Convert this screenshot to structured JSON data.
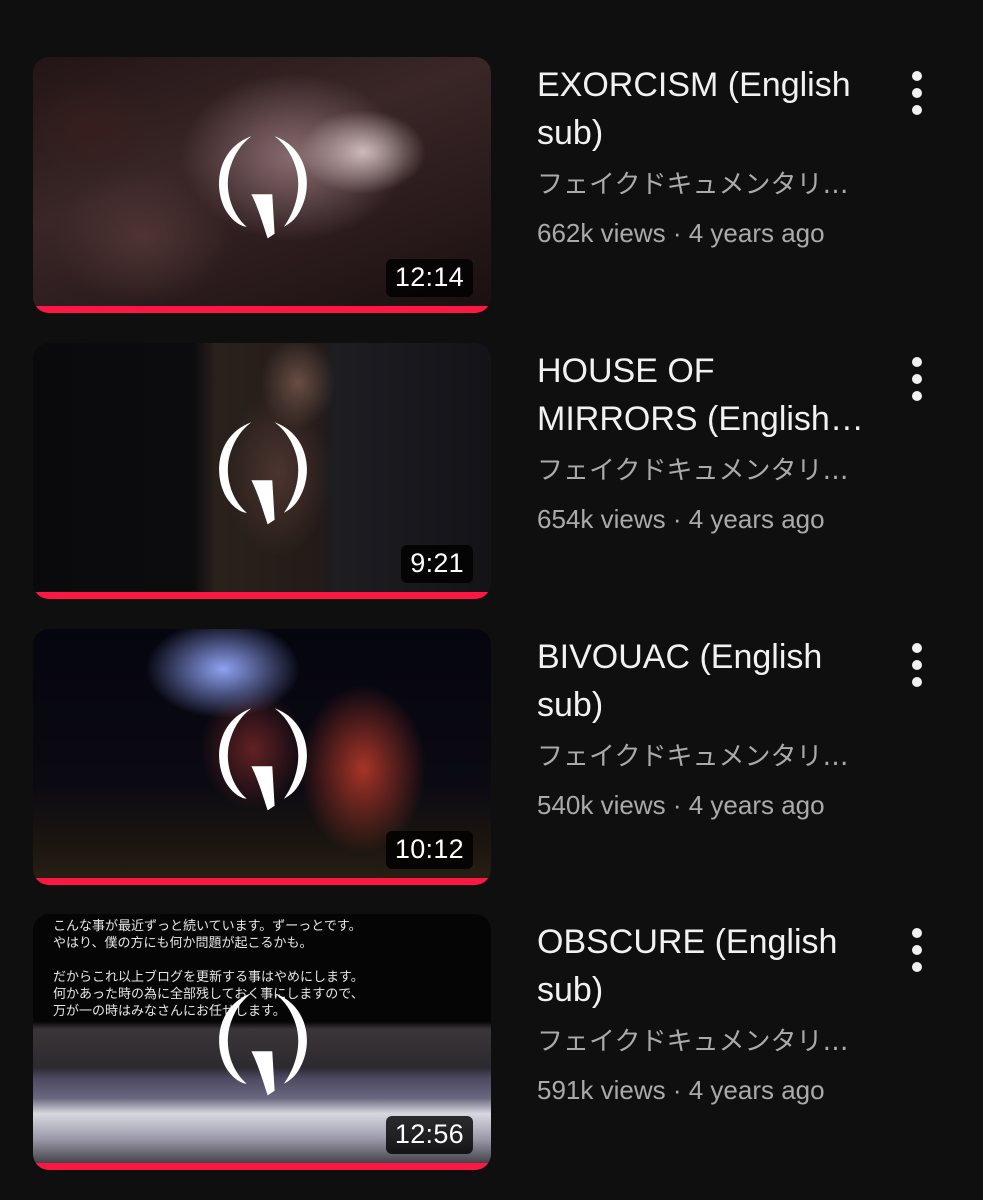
{
  "videos": [
    {
      "title": "EXORCISM (English sub)",
      "channel": "フェイクドキュメンタリー「Q」",
      "views": "662k views",
      "age": "4 years ago",
      "duration": "12:14",
      "watched_fraction": 1.0
    },
    {
      "title": "HOUSE OF MIRRORS (English sub)",
      "channel": "フェイクドキュメンタリー「Q」",
      "views": "654k views",
      "age": "4 years ago",
      "duration": "9:21",
      "watched_fraction": 1.0
    },
    {
      "title": "BIVOUAC (English sub)",
      "channel": "フェイクドキュメンタリー「Q」",
      "views": "540k views",
      "age": "4 years ago",
      "duration": "10:12",
      "watched_fraction": 1.0
    },
    {
      "title": "OBSCURE (English sub)",
      "channel": "フェイクドキュメンタリー「Q」",
      "views": "591k views",
      "age": "4 years ago",
      "duration": "12:56",
      "watched_fraction": 1.0,
      "thumbnail_text": "こんな事が最近ずっと続いています。ずーっとです。\nやはり、僕の方にも何か問題が起こるかも。\n\nだからこれ以上ブログを更新する事はやめにします。\n何かあった時の為に全部残しておく事にしますので、\n万が一の時はみなさんにお任せします。"
    }
  ],
  "separator": " · ",
  "colors": {
    "background": "#0f0f0f",
    "progress": "#ff1744",
    "secondary_text": "#aaaaaa",
    "primary_text": "#f1f1f1"
  },
  "icons": {
    "menu": "more-vert-icon",
    "logo": "q-logo"
  }
}
